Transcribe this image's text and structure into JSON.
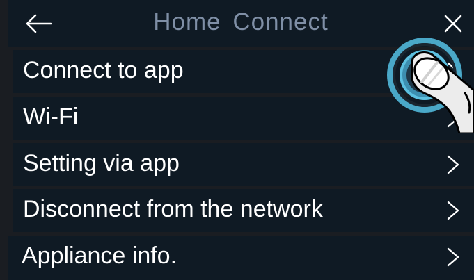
{
  "header": {
    "title": "Home  Connect",
    "back_icon": "arrow-left-icon",
    "close_icon": "close-icon"
  },
  "menu": {
    "items": [
      {
        "label": "Connect to app",
        "chevron": "chevron-right-icon"
      },
      {
        "label": "Wi-Fi",
        "chevron": "chevron-right-icon"
      },
      {
        "label": "Setting via app",
        "chevron": "chevron-right-icon"
      },
      {
        "label": "Disconnect from the network",
        "chevron": "chevron-right-icon"
      },
      {
        "label": "Appliance info.",
        "chevron": "chevron-right-icon"
      }
    ]
  },
  "colors": {
    "background": "#1a1d22",
    "panel": "#0f1a24",
    "title_text": "#7f8fa6",
    "label_text": "#ffffff",
    "touch_ring": "#4aa8c8"
  },
  "overlay": {
    "gesture": "tap-gesture-icon"
  }
}
